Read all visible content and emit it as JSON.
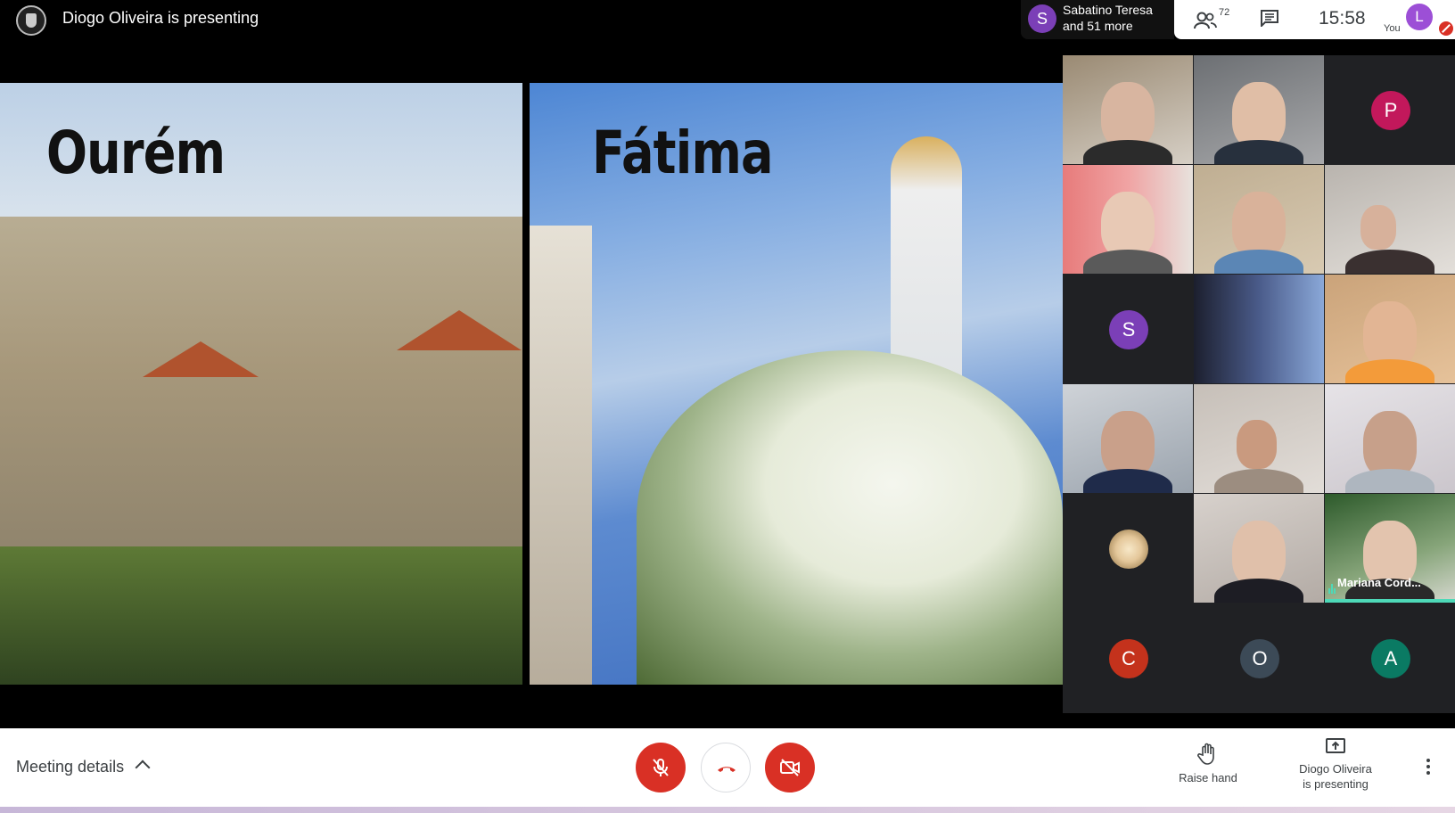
{
  "header": {
    "presenting_text": "Diogo Oliveira is presenting",
    "people_preview": {
      "avatar_letter": "S",
      "avatar_color": "#7b3fb7",
      "line1": "Sabatino Teresa",
      "line2": "and 51 more"
    },
    "participant_count": "72",
    "clock": "15:58",
    "you_label": "You",
    "self_avatar_letter": "L",
    "self_avatar_color": "#9c4fd6"
  },
  "presentation": {
    "left_label": "Ourém",
    "right_label": "Fátima"
  },
  "grid": {
    "tiles": [
      {
        "type": "video"
      },
      {
        "type": "video"
      },
      {
        "type": "avatar",
        "letter": "P",
        "color": "#c2185b"
      },
      {
        "type": "video"
      },
      {
        "type": "video"
      },
      {
        "type": "video"
      },
      {
        "type": "avatar",
        "letter": "S",
        "color": "#7b3fb7"
      },
      {
        "type": "video"
      },
      {
        "type": "video"
      },
      {
        "type": "video"
      },
      {
        "type": "video"
      },
      {
        "type": "video"
      },
      {
        "type": "avatar-image"
      },
      {
        "type": "video"
      },
      {
        "type": "video",
        "name": "Mariana Cord..."
      },
      {
        "type": "avatar",
        "letter": "C",
        "color": "#c4321c"
      },
      {
        "type": "avatar",
        "letter": "O",
        "color": "#3c4a57"
      },
      {
        "type": "avatar",
        "letter": "A",
        "color": "#0a7a63"
      }
    ],
    "speaking_name": "Mariana Cord..."
  },
  "controls": {
    "meeting_details_label": "Meeting details",
    "raise_hand_label": "Raise hand",
    "presenter_line1": "Diogo Oliveira",
    "presenter_line2": "is presenting",
    "accent_red": "#d93025"
  }
}
